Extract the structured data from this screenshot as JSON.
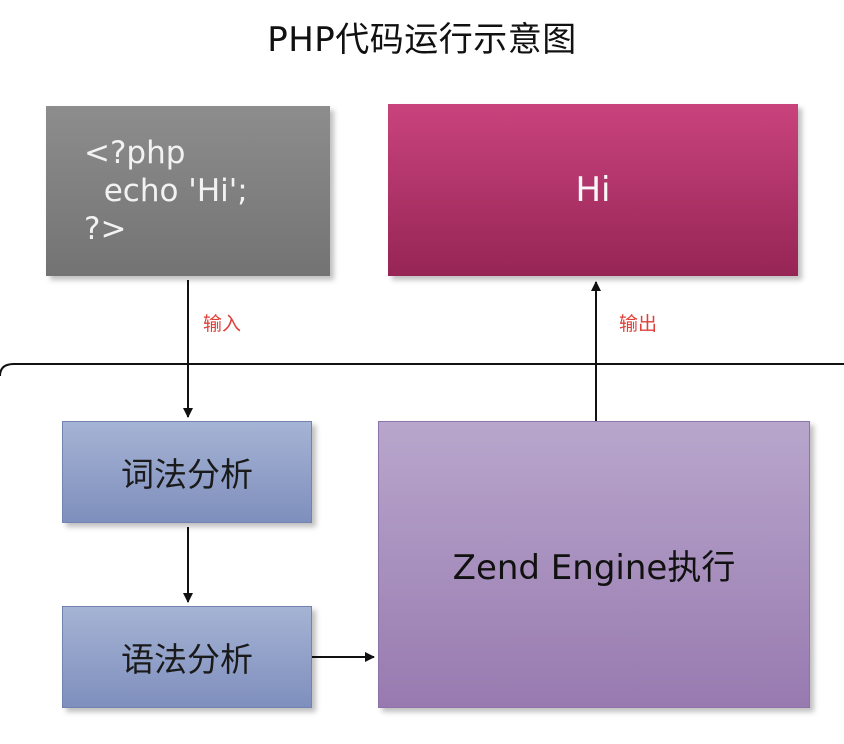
{
  "title": "PHP代码运行示意图",
  "code_box": {
    "line1": "<?php",
    "line2": "  echo 'Hi';",
    "line3": "?>"
  },
  "output_box": {
    "label": "Hi"
  },
  "steps": {
    "lexer": "词法分析",
    "parser": "语法分析",
    "engine": "Zend Engine执行"
  },
  "edges": {
    "input": "输入",
    "output": "输出"
  },
  "colors": {
    "code_box": "#808080",
    "output_box": "#b3346a",
    "step_box": "#95a3cc",
    "engine_box": "#a891bf",
    "edge_label": "#e0403a"
  }
}
